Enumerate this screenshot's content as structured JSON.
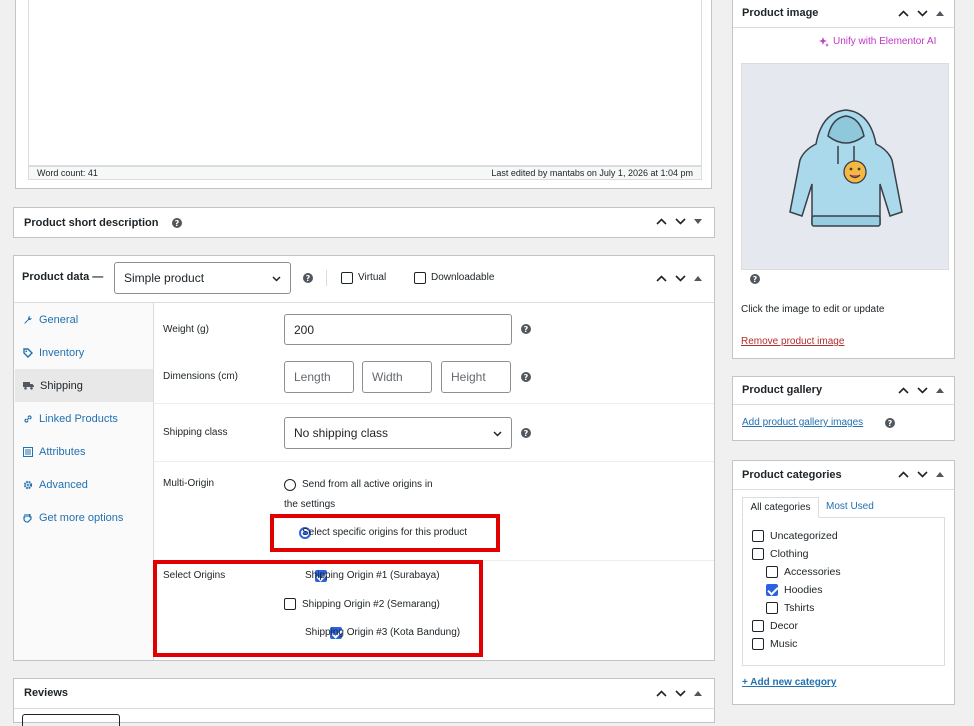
{
  "editor": {
    "word_count": "Word count: 41",
    "last_edited": "Last edited by mantabs on July 1, 2026 at 1:04 pm"
  },
  "short_desc": {
    "title": "Product short description"
  },
  "product_data": {
    "title": "Product data —",
    "type_value": "Simple product",
    "virtual_label": "Virtual",
    "downloadable_label": "Downloadable",
    "tabs": [
      {
        "label": "General",
        "icon": "wrench-icon"
      },
      {
        "label": "Inventory",
        "icon": "tag-icon"
      },
      {
        "label": "Shipping",
        "icon": "truck-icon"
      },
      {
        "label": "Linked Products",
        "icon": "link-icon"
      },
      {
        "label": "Attributes",
        "icon": "list-icon"
      },
      {
        "label": "Advanced",
        "icon": "gear-icon"
      },
      {
        "label": "Get more options",
        "icon": "plugin-icon"
      }
    ],
    "weight_label": "Weight (g)",
    "weight_value": "200",
    "dimensions_label": "Dimensions (cm)",
    "length_ph": "Length",
    "width_ph": "Width",
    "height_ph": "Height",
    "shipping_class_label": "Shipping class",
    "shipping_class_value": "No shipping class",
    "multi_origin_label": "Multi-Origin",
    "option_all_line1": "Send from all active origins in",
    "option_all_line2": "the settings",
    "option_specific": "Select specific origins for this product",
    "select_origins_label": "Select Origins",
    "origins": [
      {
        "label": "Shipping Origin #1 (Surabaya)",
        "checked": true
      },
      {
        "label": "Shipping Origin #2 (Semarang)",
        "checked": false
      },
      {
        "label": "Shipping Origin #3 (Kota Bandung)",
        "checked": true
      }
    ]
  },
  "reviews": {
    "title": "Reviews"
  },
  "product_image": {
    "title": "Product image",
    "elementor_link": "Unify with Elementor AI",
    "click_hint": "Click the image to edit or update",
    "remove_link": "Remove product image"
  },
  "product_gallery": {
    "title": "Product gallery",
    "add_link": "Add product gallery images"
  },
  "product_categories": {
    "title": "Product categories",
    "tab_all": "All categories",
    "tab_most_used": "Most Used",
    "items": [
      {
        "label": "Uncategorized",
        "checked": false,
        "indent": 0
      },
      {
        "label": "Clothing",
        "checked": false,
        "indent": 0
      },
      {
        "label": "Accessories",
        "checked": false,
        "indent": 1
      },
      {
        "label": "Hoodies",
        "checked": true,
        "indent": 1
      },
      {
        "label": "Tshirts",
        "checked": false,
        "indent": 1
      },
      {
        "label": "Decor",
        "checked": false,
        "indent": 0
      },
      {
        "label": "Music",
        "checked": false,
        "indent": 0
      }
    ],
    "add_link": "+ Add new category"
  },
  "colors": {
    "accent": "#2271b1",
    "highlight": "#e00000",
    "checked": "#2c62e0"
  }
}
